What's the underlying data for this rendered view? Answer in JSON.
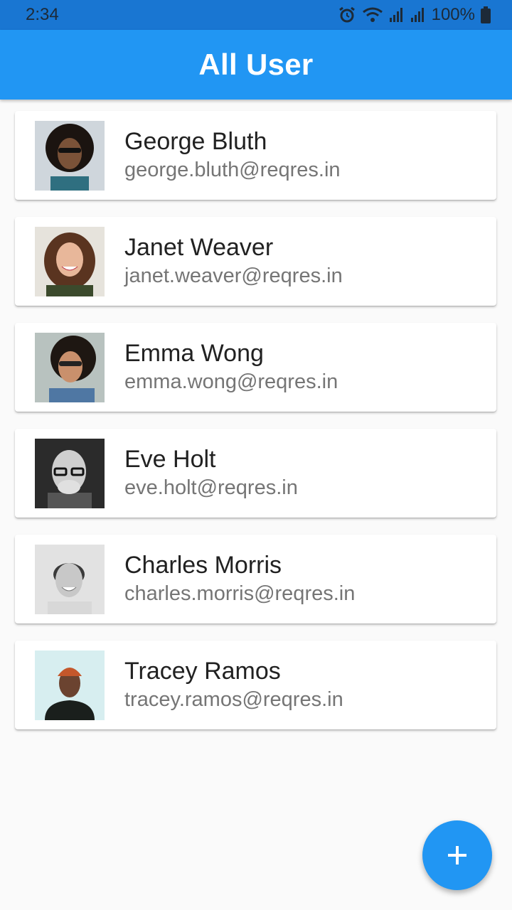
{
  "status_bar": {
    "time": "2:34",
    "battery": "100%",
    "icons": [
      "alarm-icon",
      "wifi-icon",
      "signal-icon",
      "signal-icon",
      "battery-icon"
    ]
  },
  "app_bar": {
    "title": "All User"
  },
  "users": [
    {
      "name": "George Bluth",
      "email": "george.bluth@reqres.in",
      "avatar_bg": "#cfd6dc",
      "skin": "#7a5238",
      "hair": "#1b1410",
      "shirt": "#2f6f80"
    },
    {
      "name": "Janet Weaver",
      "email": "janet.weaver@reqres.in",
      "avatar_bg": "#e6e3dc",
      "skin": "#e8b79a",
      "hair": "#5a3420",
      "shirt": "#3b4a2c"
    },
    {
      "name": "Emma Wong",
      "email": "emma.wong@reqres.in",
      "avatar_bg": "#b8c2bf",
      "skin": "#c9906c",
      "hair": "#1e1712",
      "shirt": "#4f77a3"
    },
    {
      "name": "Eve Holt",
      "email": "eve.holt@reqres.in",
      "avatar_bg": "#2b2b2b",
      "skin": "#cfcfcf",
      "hair": "#e0e0e0",
      "shirt": "#555555"
    },
    {
      "name": "Charles Morris",
      "email": "charles.morris@reqres.in",
      "avatar_bg": "#e2e2e2",
      "skin": "#c8c8c8",
      "hair": "#3a3a3a",
      "shirt": "#d8d8d8"
    },
    {
      "name": "Tracey Ramos",
      "email": "tracey.ramos@reqres.in",
      "avatar_bg": "#d7eef0",
      "skin": "#6b4330",
      "hair": "#c4572b",
      "shirt": "#1a1f1c"
    }
  ],
  "fab": {
    "icon": "plus-icon"
  }
}
